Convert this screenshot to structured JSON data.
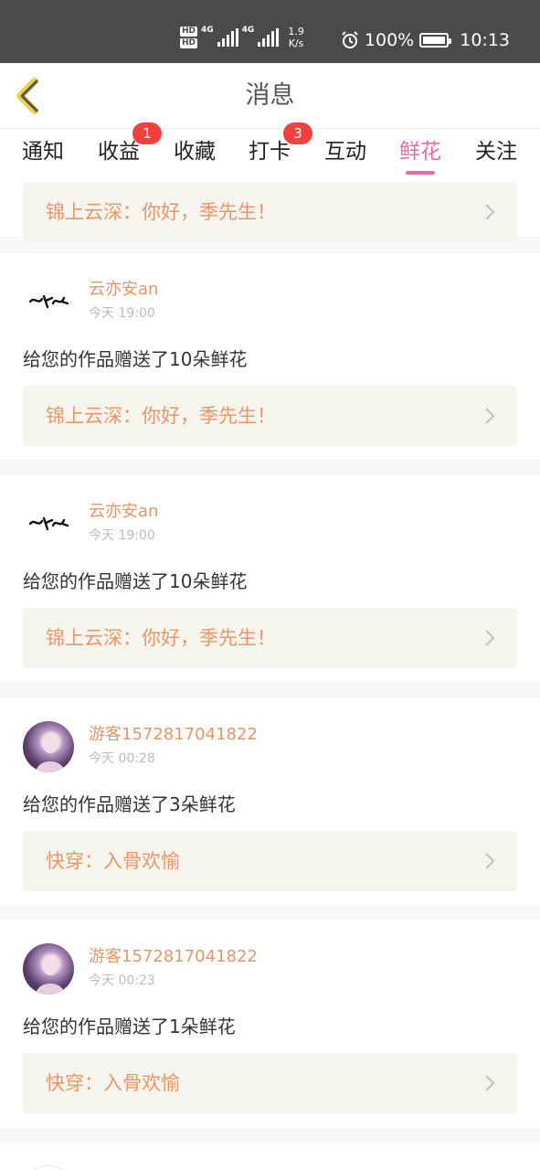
{
  "status_bar": {
    "hd1": "HD",
    "hd2": "HD",
    "signal1_label": "4G",
    "signal2_label": "4G",
    "net_speed_value": "1.9",
    "net_speed_unit": "K/s",
    "battery_percent": "100%",
    "time": "10:13"
  },
  "header": {
    "title": "消息",
    "back_icon": "chevron-left-icon"
  },
  "tabs": [
    {
      "label": "通知",
      "badge": ""
    },
    {
      "label": "收益",
      "badge": "1"
    },
    {
      "label": "收藏",
      "badge": ""
    },
    {
      "label": "打卡",
      "badge": "3"
    },
    {
      "label": "互动",
      "badge": ""
    },
    {
      "label": "鲜花",
      "badge": "",
      "active": true
    },
    {
      "label": "关注",
      "badge": ""
    }
  ],
  "accent_color": "#e06fa8",
  "badge_color": "#f2403c",
  "name_color": "#e0976a",
  "messages": [
    {
      "book": "锦上云深：你好，季先生！",
      "partial": true
    },
    {
      "author": "云亦安an",
      "time": "今天 19:00",
      "text": "给您的作品赠送了10朵鲜花",
      "book": "锦上云深：你好，季先生！",
      "avatar": "calligraphy"
    },
    {
      "author": "云亦安an",
      "time": "今天 19:00",
      "text": "给您的作品赠送了10朵鲜花",
      "book": "锦上云深：你好，季先生！",
      "avatar": "calligraphy"
    },
    {
      "author": "游客1572817041822",
      "time": "今天 00:28",
      "text": "给您的作品赠送了3朵鲜花",
      "book": "快穿：入骨欢愉",
      "avatar": "photo"
    },
    {
      "author": "游客1572817041822",
      "time": "今天 00:23",
      "text": "给您的作品赠送了1朵鲜花",
      "book": "快穿：入骨欢愉",
      "avatar": "photo"
    }
  ]
}
